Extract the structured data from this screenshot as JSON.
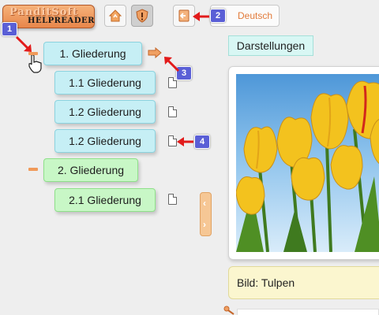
{
  "logo": {
    "brand": "PanditSoft",
    "product": "HELPREADER"
  },
  "toolbar": {
    "language_label": "Deutsch"
  },
  "badges": [
    "1",
    "2",
    "3",
    "4"
  ],
  "tree": {
    "nodes": [
      {
        "label": "1. Gliederung",
        "level": 1
      },
      {
        "label": "1.1 Gliederung",
        "level": 2
      },
      {
        "label": "1.2 Gliederung",
        "level": 2
      },
      {
        "label": "1.2 Gliederung",
        "level": 2
      },
      {
        "label": "2. Gliederung",
        "level": 1
      },
      {
        "label": "2.1 Gliederung",
        "level": 2
      }
    ]
  },
  "content": {
    "section_title": "Darstellungen",
    "image_caption": "Bild: Tulpen"
  },
  "icons": {
    "home": "home-icon",
    "alert": "alert-shield-icon",
    "back": "back-document-icon",
    "page": "page-icon",
    "next": "next-arrow-icon",
    "collapse": "collapse-minus-icon"
  },
  "colors": {
    "accent_orange": "#e8864a",
    "badge_blue": "#5a5fd6",
    "node_cyan": "#c6eff5",
    "node_green": "#c8f7c6",
    "caption_yellow": "#fbf6cf"
  }
}
